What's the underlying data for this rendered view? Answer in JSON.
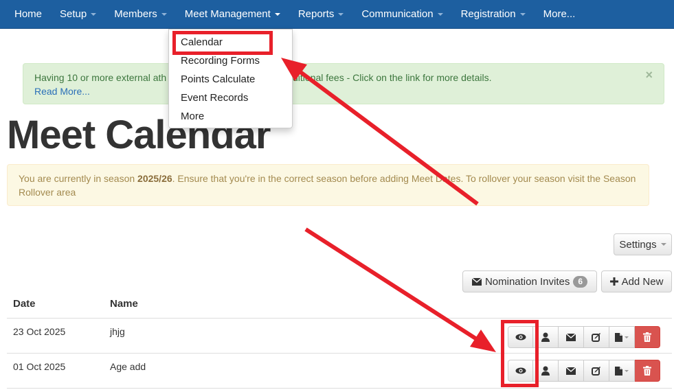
{
  "nav": {
    "items": [
      {
        "label": "Home",
        "caret": false
      },
      {
        "label": "Setup",
        "caret": true
      },
      {
        "label": "Members",
        "caret": true
      },
      {
        "label": "Meet Management",
        "caret": true
      },
      {
        "label": "Reports",
        "caret": true
      },
      {
        "label": "Communication",
        "caret": true
      },
      {
        "label": "Registration",
        "caret": true
      },
      {
        "label": "More...",
        "caret": false
      }
    ]
  },
  "dropdown": {
    "items": [
      "Calendar",
      "Recording Forms",
      "Points Calculate",
      "Event Records",
      "More"
    ]
  },
  "alert_success": {
    "text_left": "Having 10 or more external ath",
    "text_right": "dditional fees - Click on the link for more details.",
    "read_more": "Read More...",
    "close": "×"
  },
  "page_title": "Meet Calendar",
  "alert_warning": {
    "prefix": "You are currently in season ",
    "season": "2025/26",
    "suffix": ". Ensure that you're in the correct season before adding Meet Dates. To rollover your season visit the Season Rollover area"
  },
  "buttons": {
    "settings": "Settings",
    "nomination_invites": "Nomination Invites",
    "nomination_count": "6",
    "add_new": "Add New"
  },
  "table": {
    "headers": {
      "date": "Date",
      "name": "Name"
    },
    "rows": [
      {
        "date": "23 Oct 2025",
        "name": "jhjg"
      },
      {
        "date": "01 Oct 2025",
        "name": "Age add"
      }
    ],
    "row_actions": [
      "eye-icon",
      "user-icon",
      "envelope-icon",
      "edit-icon",
      "file-icon",
      "trash-icon"
    ]
  },
  "colors": {
    "navbar": "#1d5fa0",
    "annotation": "#e8202a",
    "danger": "#d9534f"
  }
}
